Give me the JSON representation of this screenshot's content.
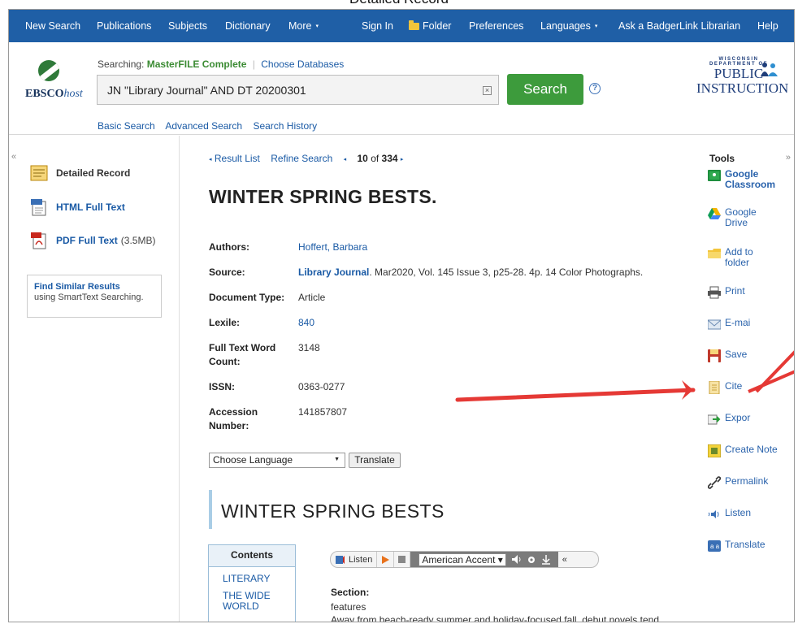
{
  "caption": "Detailed Record",
  "topnav": {
    "items": [
      "New Search",
      "Publications",
      "Subjects",
      "Dictionary",
      "More"
    ],
    "more_caret": "▾",
    "right_items": [
      "Sign In",
      "Folder",
      "Preferences",
      "Languages",
      "Ask a BadgerLink Librarian",
      "Help"
    ],
    "languages_caret": "▾",
    "bg_color": "#1f5fa6"
  },
  "header": {
    "logo_main": "EBSCO",
    "logo_host": "host",
    "searching_prefix": "Searching:",
    "database": "MasterFILE Complete",
    "separator": "|",
    "choose_databases": "Choose Databases",
    "query": "JN \"Library Journal\" AND DT 20200301",
    "clear_icon": "×",
    "search_button": "Search",
    "help_icon": "?",
    "links": [
      "Basic Search",
      "Advanced Search",
      "Search History"
    ],
    "dpi_small_1": "WISCONSIN",
    "dpi_small_2": "DEPARTMENT OF",
    "dpi_big_1": "PUBLIC",
    "dpi_big_2": "INSTRUCTION"
  },
  "left_panel": {
    "collapse_icon": "«",
    "items": [
      {
        "label": "Detailed Record",
        "icon": "detailed-record-icon"
      },
      {
        "label": "HTML Full Text",
        "icon": "html-icon"
      },
      {
        "label": "PDF Full Text",
        "size": "(3.5MB)",
        "icon": "pdf-icon"
      }
    ],
    "find_similar_title": "Find Similar Results",
    "find_similar_sub": "using SmartText Searching."
  },
  "record": {
    "result_list": "Result List",
    "refine_search": "Refine Search",
    "position": "10",
    "of_label": "of",
    "total": "334",
    "prev_icon": "◂",
    "next_icon": "▸",
    "title": "WINTER SPRING BESTS.",
    "fields": {
      "authors_k": "Authors:",
      "authors_v": "Hoffert, Barbara",
      "source_k": "Source:",
      "source_journal": "Library Journal",
      "source_rest": ". Mar2020, Vol. 145 Issue 3, p25-28. 4p. 14 Color Photographs.",
      "doctype_k": "Document Type:",
      "doctype_v": "Article",
      "lexile_k": "Lexile:",
      "lexile_v": "840",
      "wordcount_k1": "Full Text Word",
      "wordcount_k2": "Count:",
      "wordcount_v": "3148",
      "issn_k": "ISSN:",
      "issn_v": "0363-0277",
      "accession_k": "Accession Number:",
      "accession_v": "141857807"
    },
    "choose_language": "Choose Language",
    "translate_button": "Translate",
    "fulltext_title": "WINTER SPRING BESTS",
    "contents_header": "Contents",
    "contents_links": [
      "LITERARY",
      "THE WIDE",
      "WORLD"
    ],
    "listen": {
      "label": "Listen",
      "accent": "American Accent",
      "collapse": "«"
    },
    "section_label": "Section:",
    "section_value": "features",
    "body_start": "Away from beach-ready summer and holiday-focused fall, debut novels tend"
  },
  "tools": {
    "header": "Tools",
    "collapse_icon": "»",
    "items": [
      {
        "label": "Google",
        "label2": "Classroom",
        "bold": true
      },
      {
        "label": "Google",
        "label2": "Drive"
      },
      {
        "label": "Add to",
        "label2": "folder"
      },
      {
        "label": "Print"
      },
      {
        "label": "E-mai"
      },
      {
        "label": "Save"
      },
      {
        "label": "Cite"
      },
      {
        "label": "Expor"
      },
      {
        "label": "Create Note"
      },
      {
        "label": "Permalink"
      },
      {
        "label": "Listen"
      },
      {
        "label": "Translate"
      }
    ]
  },
  "colors": {
    "accent_red": "#e53935",
    "search_green": "#3d9b3c",
    "link_blue": "#1a5aa5"
  }
}
